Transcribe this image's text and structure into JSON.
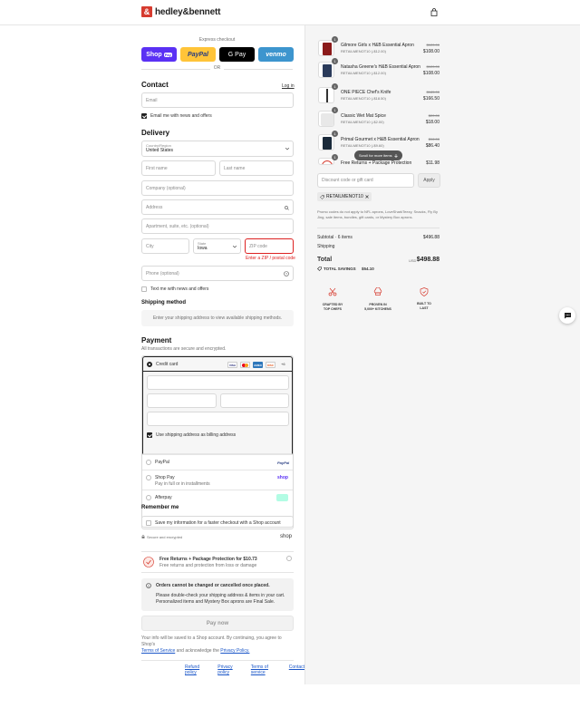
{
  "header": {
    "brand": "hedley&bennett",
    "logo_mark": "&"
  },
  "express": {
    "label": "Express checkout",
    "buttons": [
      {
        "label": "Shop",
        "sub": "Pay",
        "bg": "#5a31f4",
        "fg": "#ffffff"
      },
      {
        "label": "PayPal",
        "bg": "#ffc439",
        "fg": "#253b80"
      },
      {
        "label": "G Pay",
        "bg": "#000000",
        "fg": "#ffffff"
      },
      {
        "label": "venmo",
        "bg": "#3d95ce",
        "fg": "#ffffff"
      }
    ],
    "or": "OR"
  },
  "contact": {
    "title": "Contact",
    "login": "Log in",
    "email_placeholder": "Email",
    "news_label": "Email me with news and offers"
  },
  "delivery": {
    "title": "Delivery",
    "country_label": "Country/Region",
    "country_value": "United States",
    "first_name": "First name",
    "last_name": "Last name",
    "company": "Company (optional)",
    "address": "Address",
    "apartment": "Apartment, suite, etc. (optional)",
    "city": "City",
    "state_label": "State",
    "state_value": "Iowa",
    "zip": "ZIP code",
    "zip_error": "Enter a ZIP / postal code",
    "phone": "Phone (optional)",
    "text_label": "Text me with news and offers"
  },
  "shipping_method": {
    "title": "Shipping method",
    "message": "Enter your shipping address to view available shipping methods."
  },
  "payment": {
    "title": "Payment",
    "subtitle": "All transactions are secure and encrypted.",
    "credit_card": "Credit card",
    "cards": [
      "VISA",
      "MC",
      "AMEX",
      "DISC"
    ],
    "more_cards": "+6",
    "billing_label": "Use shipping address as billing address",
    "paypal": "PayPal",
    "paypal_logo": "PayPal",
    "shop_pay": "Shop Pay",
    "shop_pay_sub": "Pay in full or in installments",
    "shop_logo": "shop",
    "afterpay": "Afterpay"
  },
  "remember": {
    "title": "Remember me",
    "label": "Save my information for a faster checkout with a Shop account",
    "secure": "Secure and encrypted",
    "shop_logo": "shop"
  },
  "protection": {
    "title": "Free Returns + Package Protection for $10.73",
    "sub": "Free returns and protection from loss or damage"
  },
  "notice": {
    "title": "Orders cannot be changed or cancelled once placed.",
    "line1": "Please double-check your shipping address & items in your cart.",
    "line2": "Personalized items and Mystery Box aprons are Final Sale."
  },
  "pay_now": "Pay now",
  "terms": {
    "line1": "Your info will be saved to a Shop account. By continuing, you agree to Shop's",
    "tos": "Terms of Service",
    "and": "and acknowledge the",
    "privacy": "Privacy Policy."
  },
  "footer": [
    "Refund policy",
    "Privacy policy",
    "Terms of service",
    "Contact"
  ],
  "cart": {
    "items": [
      {
        "qty": "1",
        "name": "Gilmore Girls x H&B Essential Apron",
        "code": "RETAILMENOT10 (-$12.00)",
        "old": "$120.00",
        "price": "$108.00",
        "color": "#8b1a1a"
      },
      {
        "qty": "1",
        "name": "Natasha Greene's H&B Essential Apron",
        "code": "RETAILMENOT10 (-$12.00)",
        "old": "$120.00",
        "price": "$108.00",
        "color": "#2a3a5a"
      },
      {
        "qty": "1",
        "name": "ONE PIECE Chef's Knife",
        "code": "RETAILMENOT10 (-$18.50)",
        "old": "$185.00",
        "price": "$166.50",
        "color": "#333333"
      },
      {
        "qty": "1",
        "name": "Classic Wet Mat Spice",
        "code": "RETAILMENOT10 (-$2.00)",
        "old": "$20.00",
        "price": "$18.00",
        "color": "#dddddd"
      },
      {
        "qty": "1",
        "name": "Primal Gourmet x H&B Essential Apron",
        "code": "RETAILMENOT10 (-$9.60)",
        "old": "$96.00",
        "price": "$86.40",
        "color": "#1a2a3a"
      },
      {
        "qty": "1",
        "name": "Free Returns + Package Protection",
        "code": "",
        "old": "",
        "price": "$11.98",
        "color": "#f0d0c8"
      }
    ],
    "scroll_hint": "Scroll for more items",
    "discount_placeholder": "Discount code or gift card",
    "apply": "Apply",
    "applied_code": "RETAILMENOT10",
    "promo_note": "Promo codes do not apply to NFL aprons, LoveSharkTeezy, Snacks, Fly By Jing, sale items, bundles, gift cards, or Mystery Box aprons.",
    "subtotal_label": "Subtotal · 6 items",
    "subtotal": "$496.88",
    "shipping_label": "Shipping",
    "total_label": "Total",
    "currency": "USD",
    "total": "$498.88",
    "savings_label": "TOTAL SAVINGS",
    "savings": "$54.10",
    "badges": [
      {
        "icon": "scissors-icon",
        "line1": "CRAFTED BY",
        "line2": "TOP CHEFS"
      },
      {
        "icon": "chef-hat-icon",
        "line1": "PROVEN IN",
        "line2": "5,000+ KITCHENS"
      },
      {
        "icon": "shield-icon",
        "line1": "BUILT TO",
        "line2": "LAST"
      }
    ]
  }
}
